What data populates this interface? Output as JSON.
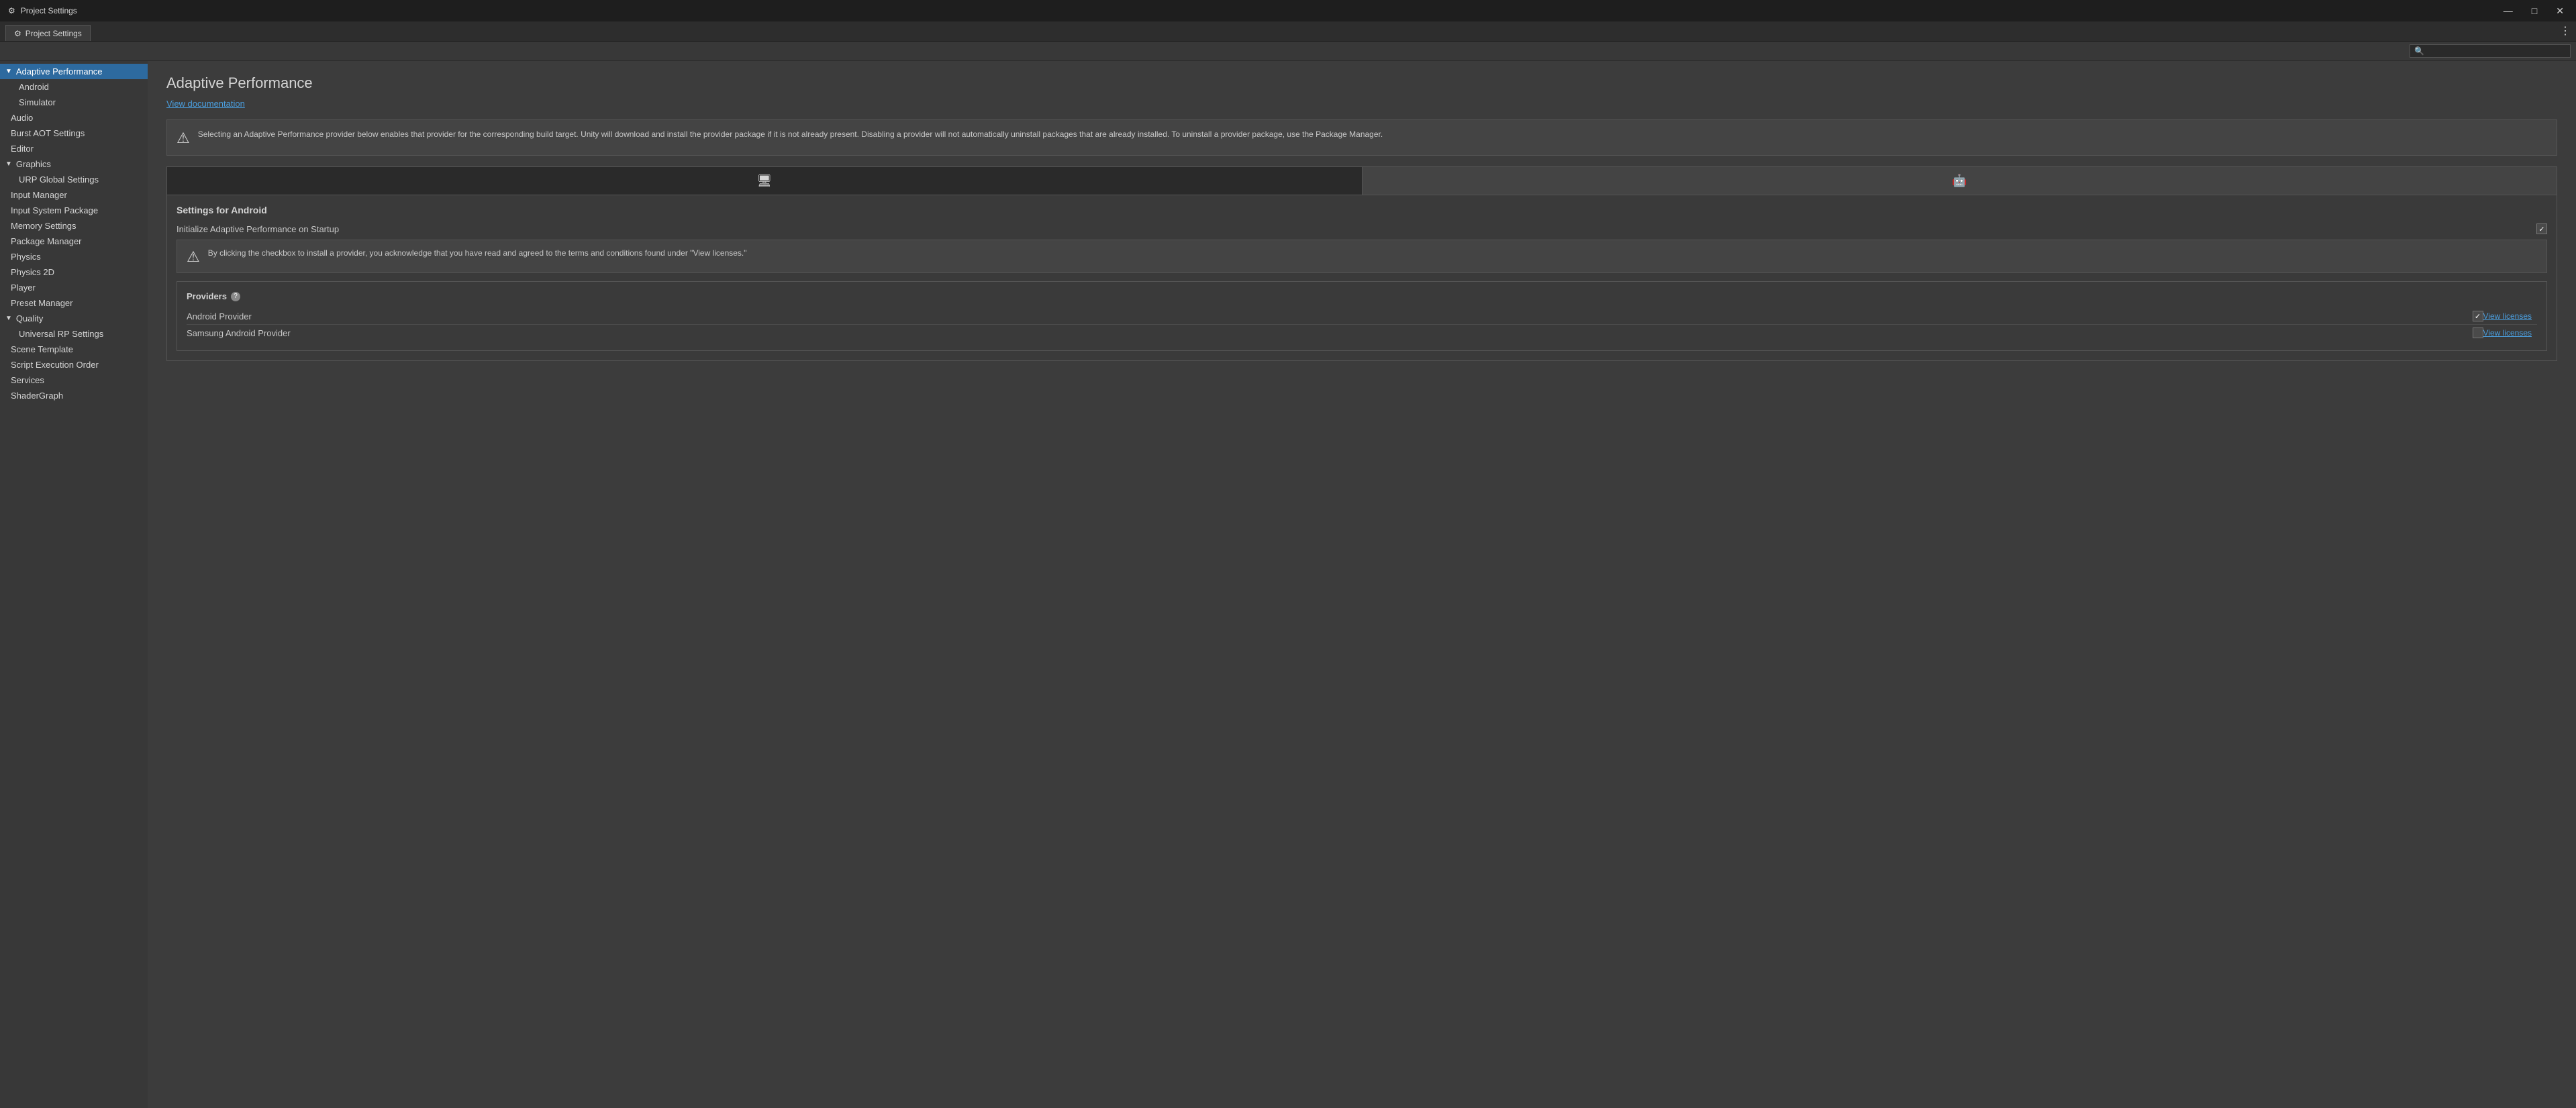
{
  "titleBar": {
    "icon": "⚙",
    "title": "Project Settings",
    "minimizeLabel": "—",
    "maximizeLabel": "□",
    "closeLabel": "✕"
  },
  "tabBar": {
    "activeTab": "Project Settings",
    "tabs": [
      {
        "icon": "⚙",
        "label": "Project Settings"
      }
    ],
    "moreLabel": "⋮"
  },
  "searchBar": {
    "placeholder": ""
  },
  "sidebar": {
    "items": [
      {
        "id": "adaptive-performance",
        "label": "Adaptive Performance",
        "type": "parent",
        "active": true,
        "expanded": true
      },
      {
        "id": "android",
        "label": "Android",
        "type": "child"
      },
      {
        "id": "simulator",
        "label": "Simulator",
        "type": "child"
      },
      {
        "id": "audio",
        "label": "Audio",
        "type": "top"
      },
      {
        "id": "burst-aot",
        "label": "Burst AOT Settings",
        "type": "top"
      },
      {
        "id": "editor",
        "label": "Editor",
        "type": "top"
      },
      {
        "id": "graphics",
        "label": "Graphics",
        "type": "parent",
        "expanded": true
      },
      {
        "id": "urp-global",
        "label": "URP Global Settings",
        "type": "child"
      },
      {
        "id": "input-manager",
        "label": "Input Manager",
        "type": "top"
      },
      {
        "id": "input-system",
        "label": "Input System Package",
        "type": "top"
      },
      {
        "id": "memory-settings",
        "label": "Memory Settings",
        "type": "top"
      },
      {
        "id": "package-manager",
        "label": "Package Manager",
        "type": "top"
      },
      {
        "id": "physics",
        "label": "Physics",
        "type": "top"
      },
      {
        "id": "physics-2d",
        "label": "Physics 2D",
        "type": "top"
      },
      {
        "id": "player",
        "label": "Player",
        "type": "top"
      },
      {
        "id": "preset-manager",
        "label": "Preset Manager",
        "type": "top"
      },
      {
        "id": "quality",
        "label": "Quality",
        "type": "parent",
        "expanded": true
      },
      {
        "id": "universal-rp",
        "label": "Universal RP Settings",
        "type": "child"
      },
      {
        "id": "scene-template",
        "label": "Scene Template",
        "type": "top"
      },
      {
        "id": "script-execution",
        "label": "Script Execution Order",
        "type": "top"
      },
      {
        "id": "services",
        "label": "Services",
        "type": "top"
      },
      {
        "id": "shader-graph",
        "label": "ShaderGraph",
        "type": "top"
      }
    ]
  },
  "content": {
    "title": "Adaptive Performance",
    "viewDocLabel": "View documentation",
    "infoBox": {
      "icon": "ⓘ",
      "text": "Selecting an Adaptive Performance provider below enables that provider for the corresponding build target. Unity will download and install the provider package if it is not already present. Disabling a provider will not automatically uninstall packages that are already installed. To uninstall a provider package, use the Package Manager."
    },
    "platformTabs": [
      {
        "id": "desktop",
        "icon": "🖥",
        "active": false
      },
      {
        "id": "android",
        "icon": "🤖",
        "active": true
      }
    ],
    "settingsForAndroid": {
      "sectionTitle": "Settings for Android",
      "initCheckboxLabel": "Initialize Adaptive Performance on Startup",
      "initChecked": true
    },
    "warningBox": {
      "icon": "ⓘ",
      "text": "By clicking the checkbox to install a provider, you acknowledge that you have read and agreed to the terms and conditions found under \"View licenses.\""
    },
    "providers": {
      "title": "Providers",
      "helpIcon": "?",
      "rows": [
        {
          "name": "Android Provider",
          "checked": true,
          "viewLicensesLabel": "View licenses"
        },
        {
          "name": "Samsung Android Provider",
          "checked": false,
          "viewLicensesLabel": "View licenses"
        }
      ]
    }
  }
}
